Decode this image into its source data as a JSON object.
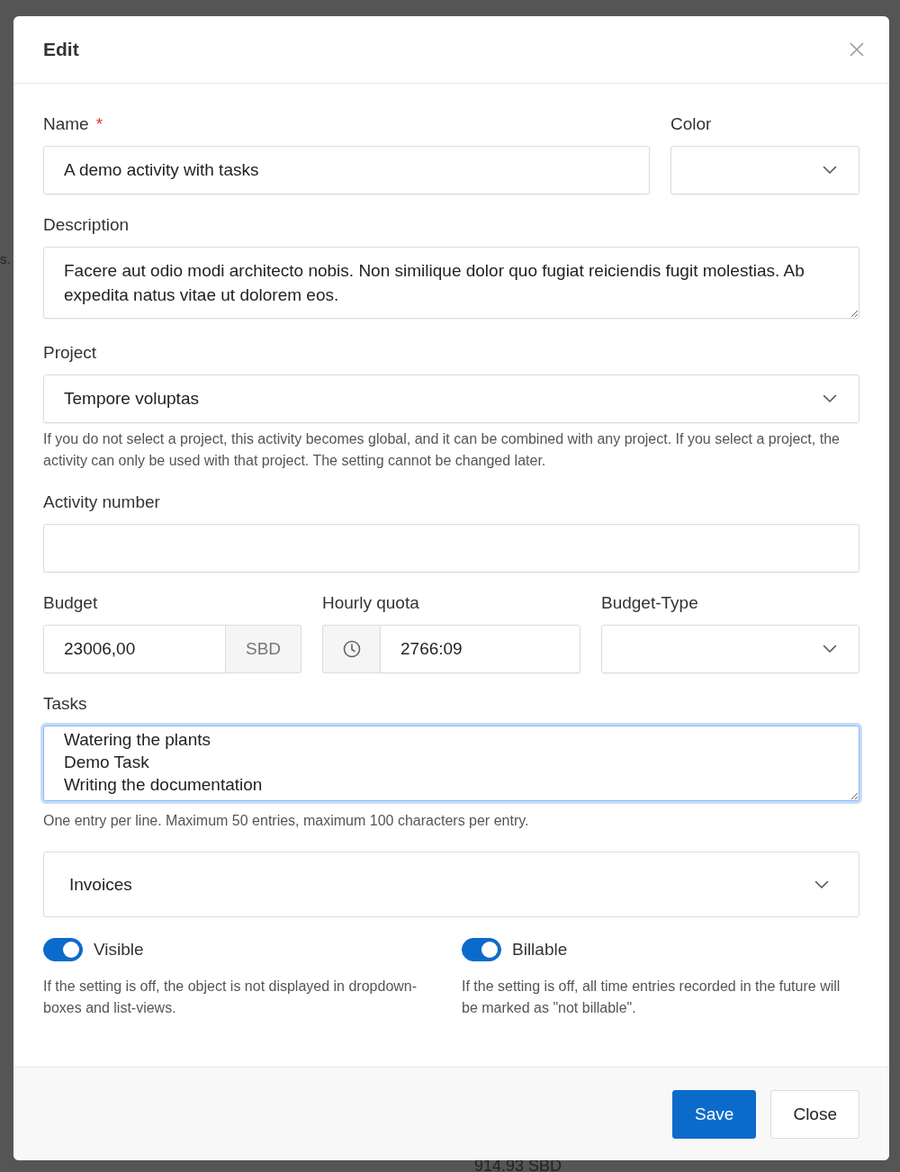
{
  "background": {
    "texts": [
      "s.",
      "914.93 SBD"
    ]
  },
  "dialog": {
    "title": "Edit",
    "name": {
      "label": "Name",
      "required_mark": "*",
      "value": "A demo activity with tasks"
    },
    "color": {
      "label": "Color"
    },
    "description": {
      "label": "Description",
      "value": "Facere aut odio modi architecto nobis. Non similique dolor quo fugiat reiciendis fugit molestias. Ab expedita natus vitae ut dolorem eos."
    },
    "project": {
      "label": "Project",
      "value": "Tempore voluptas",
      "help": "If you do not select a project, this activity becomes global, and it can be combined with any project. If you select a project, the activity can only be used with that project. The setting cannot be changed later."
    },
    "activity_number": {
      "label": "Activity number"
    },
    "budget": {
      "label": "Budget",
      "value": "23006,00",
      "currency": "SBD"
    },
    "hourly_quota": {
      "label": "Hourly quota",
      "value": "2766:09"
    },
    "budget_type": {
      "label": "Budget-Type"
    },
    "tasks": {
      "label": "Tasks",
      "value": "Watering the plants\nDemo Task\nWriting the documentation",
      "focused": true,
      "help": "One entry per line. Maximum 50 entries, maximum 100 characters per entry."
    },
    "invoices": {
      "label": "Invoices",
      "expanded": false
    },
    "switches": [
      {
        "label": "Visible",
        "on": true,
        "help": "If the setting is off, the object is not displayed in dropdown-boxes and list-views."
      },
      {
        "label": "Billable",
        "on": true,
        "help": "If the setting is off, all time entries recorded in the future will be marked as \"not billable\"."
      }
    ],
    "buttons": [
      {
        "label": "Save",
        "kind": "primary"
      },
      {
        "label": "Close",
        "kind": "secondary"
      }
    ]
  }
}
